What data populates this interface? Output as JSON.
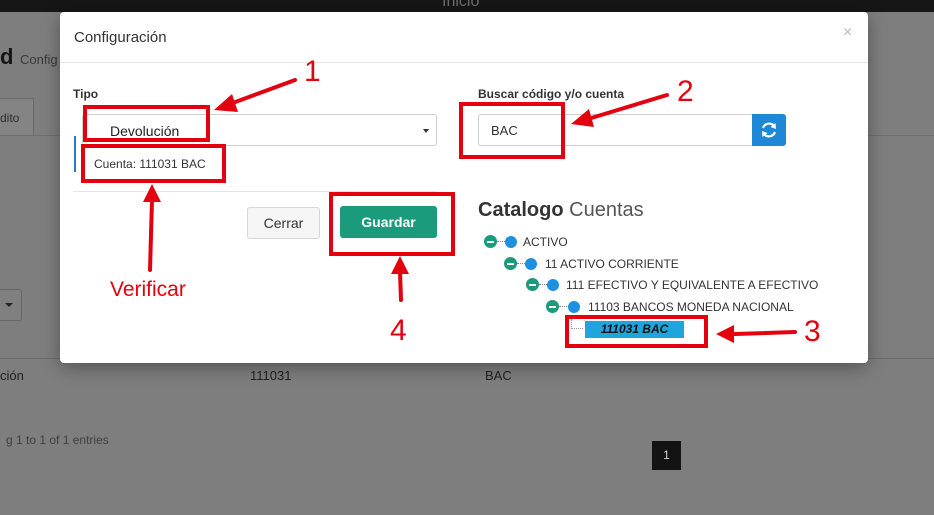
{
  "background": {
    "topbar_title": "Inicio",
    "heading_fragment": "d",
    "heading_sub": "Config",
    "tab_fragment": "dito",
    "table_cells": [
      "ción",
      "111031",
      "BAC"
    ],
    "entries_text": "g 1 to 1 of 1 entries",
    "page_number": "1"
  },
  "modal": {
    "title": "Configuración",
    "close_label": "×",
    "tipo_label": "Tipo",
    "tipo_value": "Devolución",
    "cuenta_text": "Cuenta: 111031 BAC",
    "search_label": "Buscar código y/o cuenta",
    "search_value": "BAC",
    "cerrar_label": "Cerrar",
    "guardar_label": "Guardar",
    "catalog_title": "Catalogo",
    "catalog_sub": "Cuentas",
    "tree": {
      "activo": "ACTIVO",
      "corriente": "11 ACTIVO CORRIENTE",
      "efectivo": "111 EFECTIVO Y EQUIVALENTE A EFECTIVO",
      "bancos": "11103 BANCOS MONEDA NACIONAL",
      "selected_leaf": "111031 BAC"
    }
  },
  "annotations": {
    "n1": "1",
    "n2": "2",
    "n3": "3",
    "n4": "4",
    "verificar": "Verificar",
    "color": "#e3000f"
  }
}
